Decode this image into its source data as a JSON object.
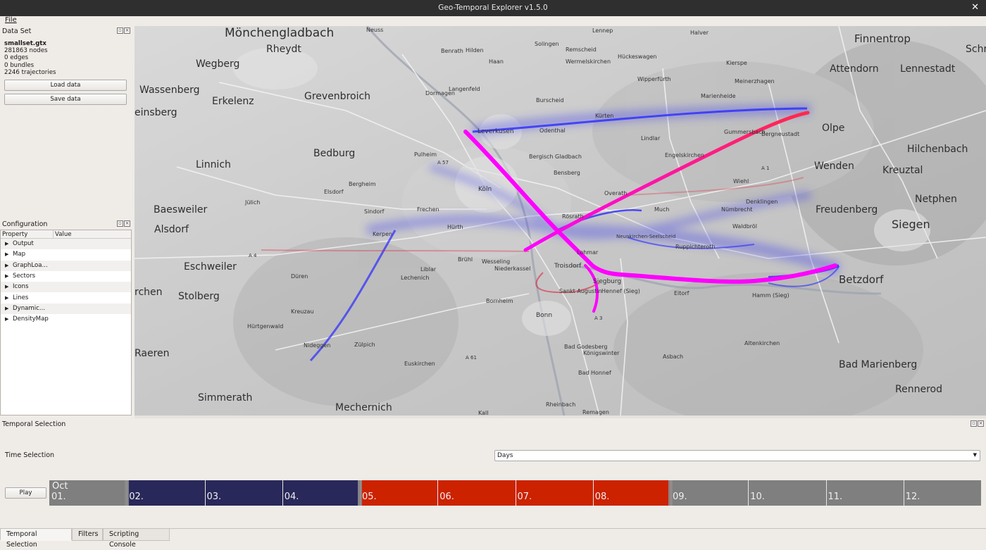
{
  "window": {
    "title": "Geo-Temporal Explorer v1.5.0",
    "close_glyph": "✕"
  },
  "menu": {
    "file_label": "File"
  },
  "dataset_panel": {
    "title": "Data Set",
    "filename": "smallset.gtx",
    "stats": [
      "281863 nodes",
      "0 edges",
      "0 bundles",
      "2246 trajectories"
    ],
    "load_button": "Load data",
    "save_button": "Save data"
  },
  "config_panel": {
    "title": "Configuration",
    "col_property": "Property",
    "col_value": "Value",
    "items": [
      "Output",
      "Map",
      "GraphLoa...",
      "Sectors",
      "Icons",
      "Lines",
      "Dynamic...",
      "DensityMap"
    ]
  },
  "map": {
    "labels": [
      "Mönchengladbach",
      "Rheydt",
      "Wegberg",
      "Wassenberg",
      "einsberg",
      "Erkelenz",
      "Grevenbroich",
      "Bedburg",
      "Linnich",
      "Baesweiler",
      "Alsdorf",
      "Eschweiler",
      "rchen",
      "Stolberg",
      "Raeren",
      "Simmerath",
      "Mechernich",
      "Finnentrop",
      "Attendorn",
      "Lennestadt",
      "Olpe",
      "Hilchenbach",
      "Wenden",
      "Kreuztal",
      "Netphen",
      "Freudenberg",
      "Siegen",
      "Betzdorf",
      "Bad Marienberg",
      "Rennerod",
      "Schr",
      "Köln",
      "Bonn",
      "Leverkusen",
      "Siegburg",
      "Troisdorf",
      "Düren",
      "Zülpich",
      "Euskirchen",
      "Bad Godesberg",
      "Bad Honnef",
      "Sankt Augustin",
      "Hennef (Sieg)",
      "Solingen",
      "Burscheid",
      "Odenthal",
      "Bergisch Gladbach",
      "Bensberg",
      "Overath",
      "Neunkirchen-Seelscheid",
      "Much",
      "Wermelskirchen",
      "Hückeswagen",
      "Wipperfürth",
      "Gummersbach",
      "Engelskirchen",
      "Lindlar",
      "Kürten",
      "Marienheide",
      "Meinerzhagen",
      "Bergneustadt",
      "Wiehl",
      "Nümbrecht",
      "Denklingen",
      "Waldbröl",
      "Ruppichteroth",
      "Eitorf",
      "Hamm (Sieg)",
      "Altenkirchen",
      "Asbach",
      "Königswinter",
      "Remagen",
      "Frechen",
      "Hürth",
      "Brühl",
      "Wesseling",
      "Niederkassel",
      "Lechenich",
      "Liblar",
      "Kerpen",
      "Sindorf",
      "Elsdorf",
      "Bergheim",
      "Pulheim",
      "Dormagen",
      "Langenfeld",
      "Hilden",
      "Benrath",
      "Neuss",
      "Haan",
      "Remscheid",
      "Lennep",
      "Halver",
      "Kierspe",
      "Jülich",
      "Kreuzau",
      "Nideggen",
      "Hürtgenwald",
      "Bornheim",
      "Lohmar",
      "Rösrath",
      "Kall",
      "Rheinbach",
      "A 4",
      "A 57",
      "A 3",
      "A 61",
      "A 1"
    ]
  },
  "temporal_panel": {
    "title": "Temporal Selection",
    "time_selection_label": "Time Selection",
    "granularity": "Days",
    "play_button": "Play",
    "month_label": "Oct",
    "days": [
      "01.",
      "02.",
      "03.",
      "04.",
      "05.",
      "06.",
      "07.",
      "08.",
      "09.",
      "10.",
      "11.",
      "12."
    ],
    "colors": {
      "unselected": "#7f7f7f",
      "blue_range": "#29285a",
      "red_range": "#cc2200"
    },
    "blue_range_days": [
      "02.",
      "03.",
      "04."
    ],
    "red_range_days": [
      "05.",
      "06.",
      "07.",
      "08."
    ]
  },
  "bottom_tabs": [
    "Temporal Selection",
    "Filters",
    "Scripting Console"
  ],
  "icons": {
    "float": "float-icon",
    "close": "close-icon",
    "expand": "expand-arrow-icon",
    "dropdown": "chevron-down-icon"
  }
}
